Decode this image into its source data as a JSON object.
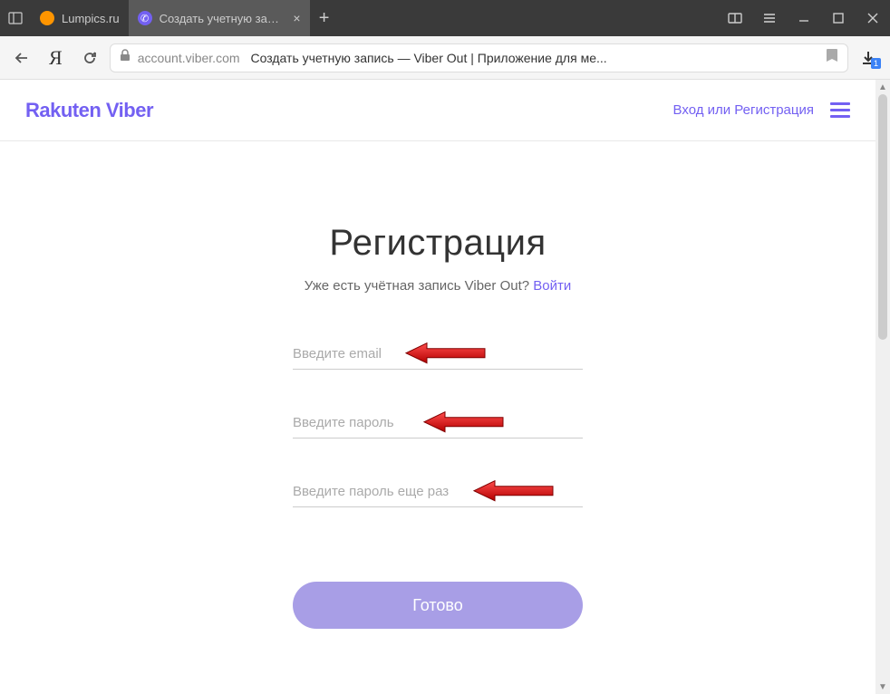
{
  "browser": {
    "tabs": [
      {
        "label": "Lumpics.ru"
      },
      {
        "label": "Создать учетную запис"
      }
    ],
    "address": {
      "domain": "account.viber.com",
      "page_title": "Создать учетную запись — Viber Out | Приложение для ме..."
    },
    "download_badge": "1"
  },
  "site": {
    "logo_rakuten": "Rakuten",
    "logo_viber": " Viber",
    "login_link": "Вход или Регистрация"
  },
  "form": {
    "title": "Регистрация",
    "subtitle_text": "Уже есть учётная запись Viber Out? ",
    "subtitle_link": "Войти",
    "email_placeholder": "Введите email",
    "password_placeholder": "Введите пароль",
    "password2_placeholder": "Введите пароль еще раз",
    "submit_label": "Готово"
  }
}
